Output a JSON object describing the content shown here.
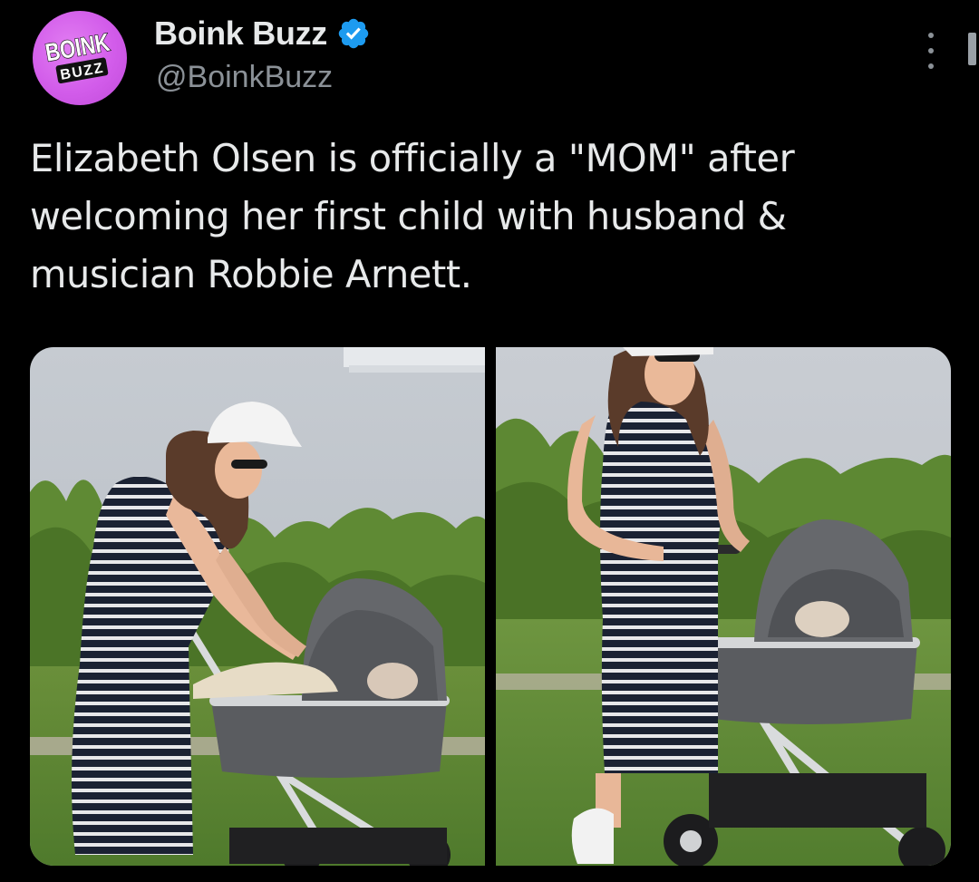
{
  "author": {
    "display_name": "Boink Buzz",
    "handle": "@BoinkBuzz",
    "avatar_logo_text": [
      "BOINK",
      "BUZZ"
    ],
    "verified": true
  },
  "tweet": {
    "text_lines": [
      "Elizabeth Olsen is officially a \"MOM\" after",
      "welcoming her first child with husband &",
      "musician Robbie Arnett."
    ]
  },
  "media": {
    "count": 2
  },
  "colors": {
    "background": "#000000",
    "text_primary": "#e7e9ea",
    "text_secondary": "#8b9197",
    "verified_badge": "#1d9bf0",
    "avatar": "#d25cea"
  }
}
